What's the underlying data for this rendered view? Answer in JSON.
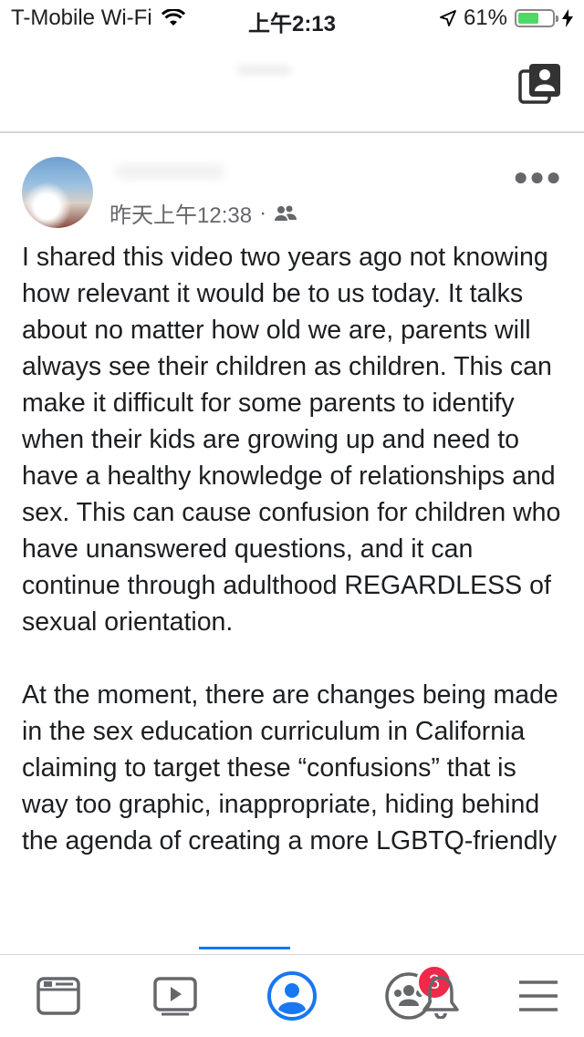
{
  "status_bar": {
    "carrier": "T-Mobile Wi-Fi",
    "time": "上午2:13",
    "battery_text": "61%",
    "battery_level": 0.61
  },
  "post": {
    "timestamp": "昨天上午12:38",
    "separator": "·",
    "paragraphs": [
      "I shared this video two years ago not knowing how relevant it would be to us today. It talks about no matter how old we are, parents will always see their children as children. This can make it difficult for some parents to identify when their kids are growing up and need to have a healthy knowledge of relationships and sex. This can cause confusion for children who have unanswered questions, and it can continue through adulthood REGARDLESS of sexual orientation.",
      "At the moment, there are changes being made in the sex education curriculum in California claiming to target these “confusions” that is way too graphic, inappropriate, hiding behind the agenda of creating a more LGBTQ-friendly"
    ]
  },
  "tabs": {
    "groups_badge": "3"
  },
  "colors": {
    "accent": "#1877f2",
    "badge": "#f02849",
    "battery": "#4cd964",
    "icon": "#65676b"
  }
}
